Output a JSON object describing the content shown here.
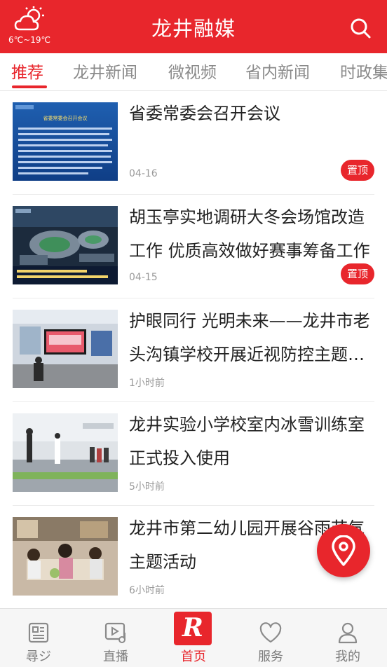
{
  "header": {
    "weather_icon": "partly-cloudy-icon",
    "weather_text": "6℃~19℃",
    "title": "龙井融媒",
    "search_icon": "search-icon"
  },
  "tabs": [
    {
      "label": "推荐",
      "active": true
    },
    {
      "label": "龙井新闻",
      "active": false
    },
    {
      "label": "微视频",
      "active": false
    },
    {
      "label": "省内新闻",
      "active": false
    },
    {
      "label": "时政集",
      "active": false
    }
  ],
  "articles": [
    {
      "title": "省委常委会召开会议",
      "time": "04-16",
      "badge": "置顶"
    },
    {
      "title": "胡玉亭实地调研大冬会场馆改造工作 优质高效做好赛事筹备工作",
      "time": "04-15",
      "badge": "置顶"
    },
    {
      "title": "护眼同行 光明未来——龙井市老头沟镇学校开展近视防控主题教育活动",
      "time": "1小时前",
      "badge": ""
    },
    {
      "title": "龙井实验小学校室内冰雪训练室正式投入使用",
      "time": "5小时前",
      "badge": ""
    },
    {
      "title": "龙井市第二幼儿园开展谷雨节气主题活动",
      "time": "6小时前",
      "badge": ""
    }
  ],
  "thumb_captions": {
    "a1_heading": "省委常委会召开会议"
  },
  "fab_icon": "location-pin-icon",
  "bottom_nav": [
    {
      "label": "尋ジ",
      "icon": "news-icon"
    },
    {
      "label": "直播",
      "icon": "live-video-icon"
    },
    {
      "label": "首页",
      "icon": "home-logo-icon"
    },
    {
      "label": "服务",
      "icon": "heart-icon"
    },
    {
      "label": "我的",
      "icon": "user-icon"
    }
  ],
  "colors": {
    "brand_red": "#e8262c",
    "tab_inactive": "#8a8a8a",
    "meta_gray": "#9a9a9a"
  }
}
